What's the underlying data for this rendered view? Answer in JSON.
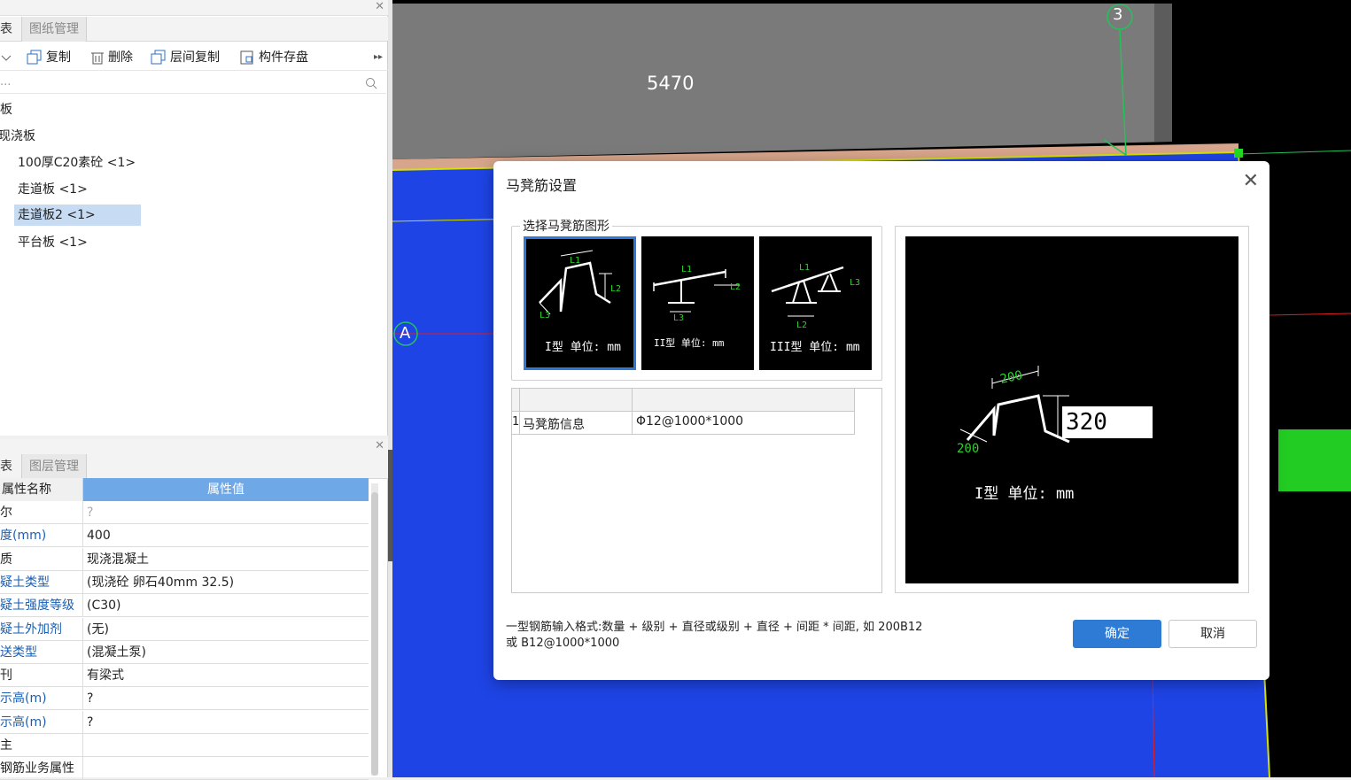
{
  "left_top": {
    "tabs": [
      "表",
      "图纸管理"
    ],
    "toolbar": [
      "复制",
      "删除",
      "层间复制",
      "构件存盘"
    ],
    "search_placeholder": "...",
    "tree": [
      {
        "label": "板"
      },
      {
        "label": "现浇板"
      },
      {
        "label": "100厚C20素砼 <1>"
      },
      {
        "label": "走道板 <1>"
      },
      {
        "label": "走道板2 <1>"
      },
      {
        "label": "平台板 <1>"
      }
    ]
  },
  "left_bottom": {
    "tabs": [
      "表",
      "图层管理"
    ],
    "header_name": "属性名称",
    "header_value": "属性值",
    "rows": [
      {
        "name": "尔",
        "value": "?"
      },
      {
        "name": "度(mm)",
        "value": "400"
      },
      {
        "name": "质",
        "value": "现浇混凝土"
      },
      {
        "name": "疑土类型",
        "value": "(现浇砼 卵石40mm 32.5)"
      },
      {
        "name": "疑土强度等级",
        "value": "(C30)"
      },
      {
        "name": "疑土外加剂",
        "value": "(无)"
      },
      {
        "name": "送类型",
        "value": "(混凝土泵)"
      },
      {
        "name": "刊",
        "value": "有梁式"
      },
      {
        "name": "示高(m)",
        "value": "?"
      },
      {
        "name": "示高(m)",
        "value": "?"
      },
      {
        "name": "主",
        "value": ""
      },
      {
        "name": "钢筋业务属性",
        "value": ""
      }
    ]
  },
  "canvas": {
    "dimension_label": "5470",
    "axis_label_top": "3",
    "axis_label_left": "A"
  },
  "dialog": {
    "title": "马凳筋设置",
    "group_title": "选择马凳筋图形",
    "shapes": [
      {
        "caption": "I型 单位: mm",
        "l1": "L1",
        "l2": "L2",
        "l3": "L3"
      },
      {
        "caption": "II型 单位: mm",
        "l1": "L1",
        "l2": "L2",
        "l3": "L3"
      },
      {
        "caption": "III型 单位: mm",
        "l1": "L1",
        "l2": "L2",
        "l3": "L3"
      }
    ],
    "grid_row_number": "1",
    "grid_row_label": "马凳筋信息",
    "grid_row_value": "Φ12@1000*1000",
    "preview": {
      "dim_top": "200",
      "dim_left": "200",
      "input_value": "320",
      "caption": "I型 单位: mm"
    },
    "hint_line1": "一型钢筋输入格式:数量 + 级别 + 直径或级别 + 直径 + 间距 * 间距, 如 200B12",
    "hint_line2": "或 B12@1000*1000",
    "ok_label": "确定",
    "cancel_label": "取消"
  }
}
